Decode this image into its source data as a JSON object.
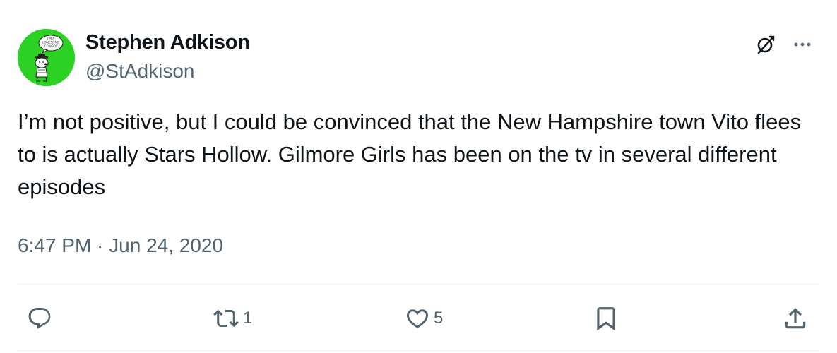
{
  "author": {
    "display_name": "Stephen Adkison",
    "handle": "@StAdkison",
    "avatar_caption": "I'M A LONESOME COWBOY"
  },
  "tweet": {
    "text": "I’m not positive, but I could be convinced that the New Hampshire town Vito flees to is actually Stars Hollow. Gilmore Girls has been on the tv in several different episodes",
    "timestamp": "6:47 PM · Jun 24, 2020"
  },
  "actions": {
    "reply": {
      "icon": "reply-icon",
      "count": ""
    },
    "retweet": {
      "icon": "retweet-icon",
      "count": "1"
    },
    "like": {
      "icon": "heart-icon",
      "count": "5"
    },
    "bookmark": {
      "icon": "bookmark-icon",
      "count": ""
    },
    "share": {
      "icon": "share-icon",
      "count": ""
    }
  },
  "top_icons": [
    "grok-icon",
    "more-icon"
  ],
  "colors": {
    "text_primary": "#0f1419",
    "text_secondary": "#536471",
    "avatar_bg": "#2bd224",
    "divider": "#eff3f4"
  }
}
